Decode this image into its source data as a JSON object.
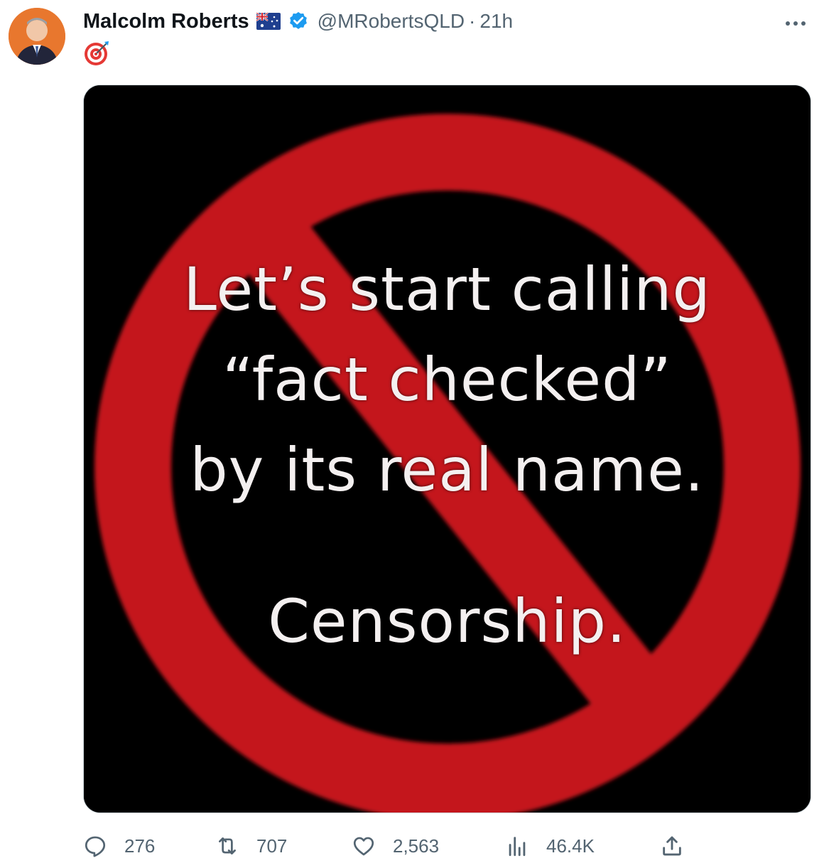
{
  "tweet": {
    "author": {
      "name": "Malcolm Roberts",
      "handle": "@MRobertsQLD",
      "time": "21h",
      "separator": "·",
      "bio_emoji": "target-emoji",
      "flag": "australia-flag",
      "verified": true
    },
    "media": {
      "lines": [
        "Let’s start calling",
        "“fact checked”",
        "by its real name.",
        "Censorship."
      ],
      "colors": {
        "background": "#000000",
        "prohibition_red": "#c4121a",
        "text": "#f4f0f0"
      }
    },
    "actions": {
      "replies": "276",
      "retweets": "707",
      "likes": "2,563",
      "views": "46.4K"
    }
  }
}
